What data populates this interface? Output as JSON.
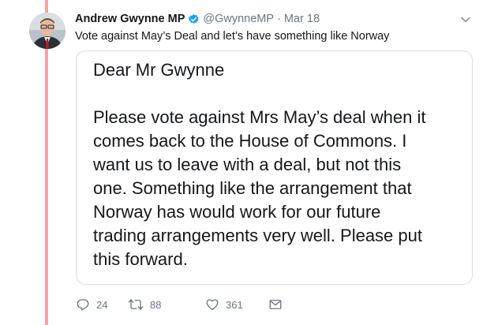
{
  "tweet": {
    "author_name": "Andrew Gwynne MP",
    "handle": "@GwynneMP",
    "separator": "·",
    "date": "Mar 18",
    "text": "Vote against May’s Deal and let’s have something like Norway",
    "icons": {
      "verified": "verified-badge-icon",
      "caret": "chevron-down-icon"
    },
    "colors": {
      "verified_blue": "#1da1f2",
      "muted_text": "#657786",
      "thread_line": "#f5a3a3"
    }
  },
  "letter": {
    "greeting": "Dear Mr Gwynne",
    "lines": [
      "Please vote against Mrs May’s deal when it",
      "comes back to the House of Commons. I",
      "want us to leave with a deal, but not this",
      "one. Something like the arrangement that",
      "Norway has would work for our future",
      "trading arrangements very well. Please put",
      "this forward."
    ]
  },
  "actions": {
    "reply_count": "24",
    "retweet_count": "88",
    "like_count": "361",
    "icons": [
      "reply-icon",
      "retweet-icon",
      "like-icon",
      "direct-message-icon"
    ]
  }
}
